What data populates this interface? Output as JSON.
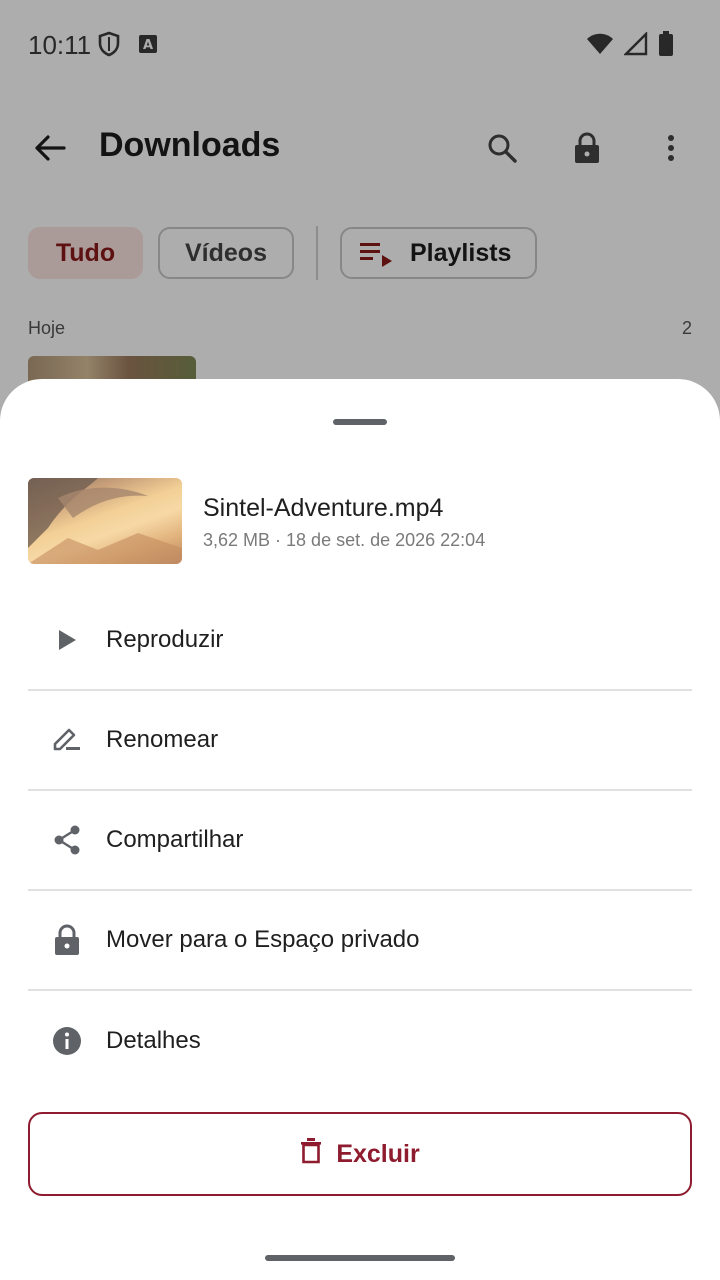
{
  "status_bar": {
    "time": "10:11",
    "icons": [
      "shield-icon",
      "keyboard-a-icon",
      "wifi-icon",
      "signal-icon",
      "battery-icon"
    ]
  },
  "app_bar": {
    "title": "Downloads",
    "icons": [
      "back-arrow-icon",
      "search-icon",
      "lock-icon",
      "more-vert-icon"
    ]
  },
  "filters": {
    "chips": [
      {
        "label": "Tudo",
        "selected": true
      },
      {
        "label": "Vídeos",
        "selected": false
      }
    ],
    "playlists_label": "Playlists"
  },
  "section": {
    "title": "Hoje",
    "count": "2"
  },
  "sheet": {
    "file": {
      "name": "Sintel-Adventure.mp4",
      "meta": "3,62 MB · 18 de set. de 2026 22:04"
    },
    "actions": [
      {
        "label": "Reproduzir",
        "icon": "play-icon"
      },
      {
        "label": "Renomear",
        "icon": "rename-icon"
      },
      {
        "label": "Compartilhar",
        "icon": "share-icon"
      },
      {
        "label": "Mover para o Espaço privado",
        "icon": "lock-icon"
      },
      {
        "label": "Detalhes",
        "icon": "info-icon"
      }
    ],
    "delete_label": "Excluir"
  },
  "colors": {
    "accent": "#8e1b2e",
    "chip_selected_bg": "#fbe3e1",
    "icon_gray": "#5f6368"
  }
}
